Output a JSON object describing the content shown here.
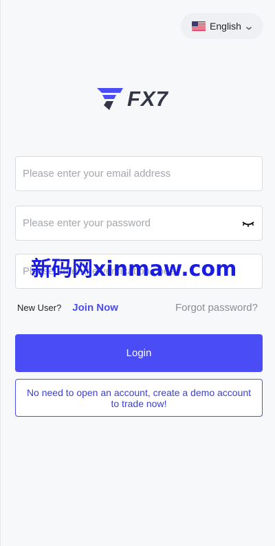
{
  "language": {
    "label": "English",
    "flag_icon": "us-flag-icon"
  },
  "brand": {
    "logo_text": "FX7",
    "logo_color": "#4a4cf5"
  },
  "form": {
    "email_placeholder": "Please enter your email address",
    "password_placeholder": "Please enter your password",
    "code_placeholder": "Please enter the verification code"
  },
  "links": {
    "new_user": "New User?",
    "join_now": "Join Now",
    "forgot_password": "Forgot password?"
  },
  "buttons": {
    "login": "Login",
    "demo": "No need to open an account, create a demo account to trade now!"
  },
  "watermark": {
    "text": "新码网xinmaw.com"
  },
  "colors": {
    "accent": "#4a4cf5",
    "link": "#4a4df0",
    "muted": "#8a8d94"
  }
}
